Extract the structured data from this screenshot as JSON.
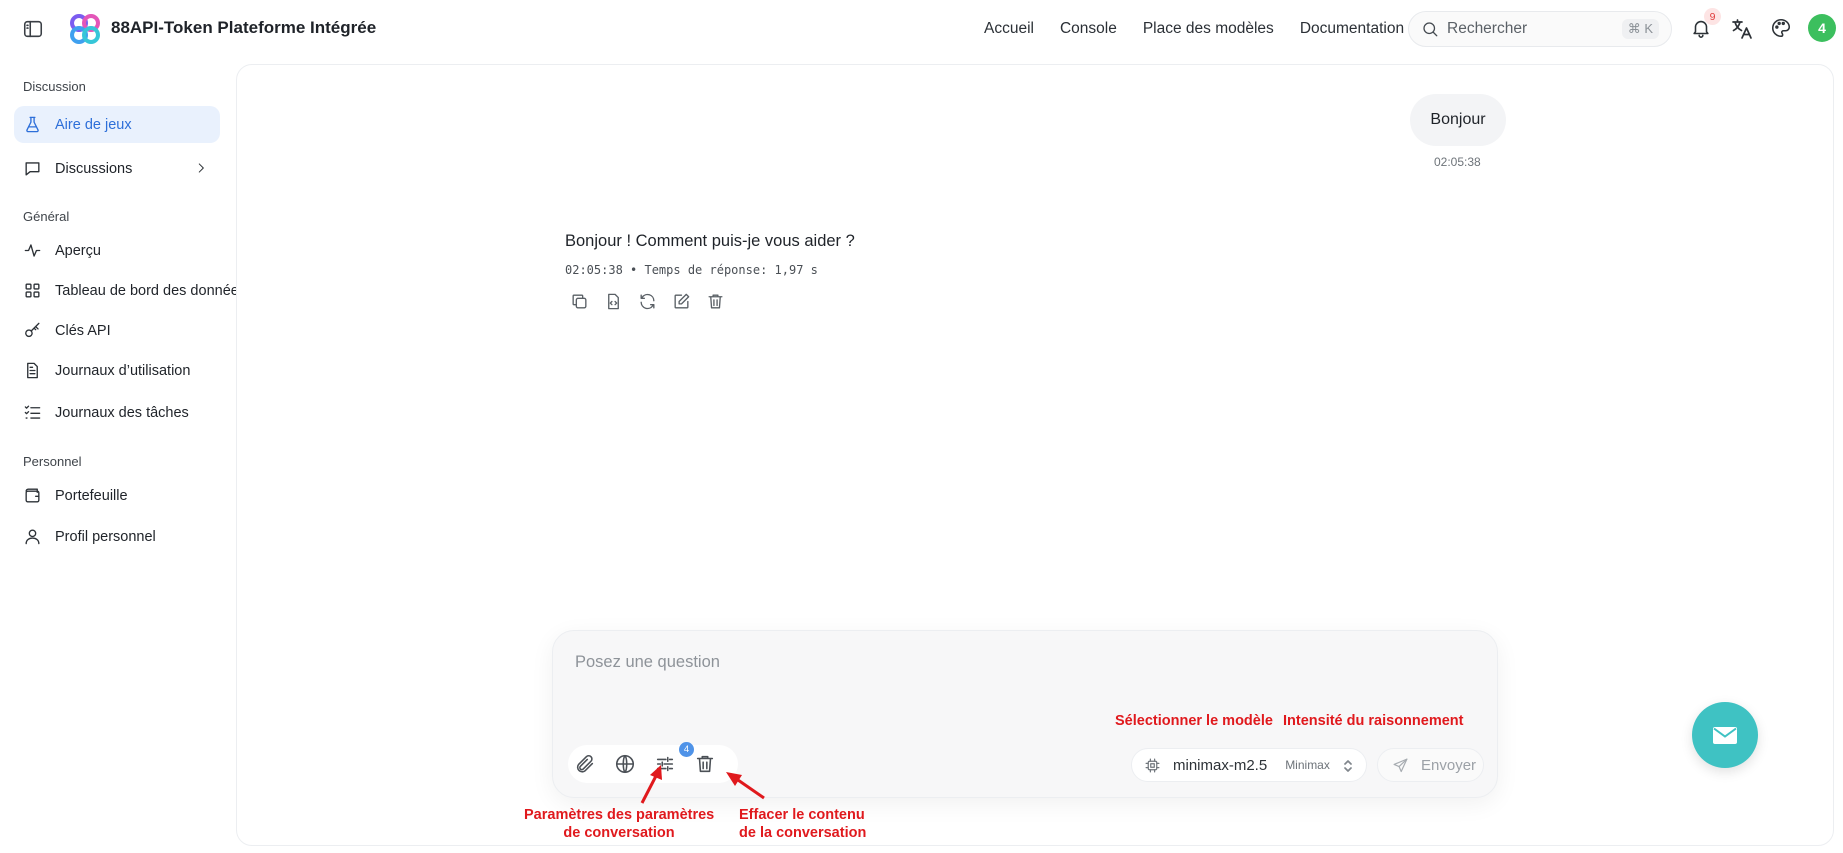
{
  "header": {
    "app_title": "88API-Token Plateforme Intégrée",
    "nav": [
      "Accueil",
      "Console",
      "Place des modèles",
      "Documentation"
    ],
    "search_placeholder": "Rechercher",
    "search_shortcut": "⌘ K",
    "notifications_count": "9",
    "avatar_initial": "4"
  },
  "sidebar": {
    "sections": [
      {
        "title": "Discussion",
        "items": [
          {
            "label": "Aire de jeux",
            "icon": "flask-icon",
            "active": true
          },
          {
            "label": "Discussions",
            "icon": "chat-icon",
            "active": false
          }
        ]
      },
      {
        "title": "Général",
        "items": [
          {
            "label": "Aperçu",
            "icon": "activity-icon"
          },
          {
            "label": "Tableau de bord des données",
            "icon": "dashboard-icon"
          },
          {
            "label": "Clés API",
            "icon": "key-icon"
          },
          {
            "label": "Journaux d’utilisation",
            "icon": "log-icon"
          },
          {
            "label": "Journaux des tâches",
            "icon": "task-list-icon"
          }
        ]
      },
      {
        "title": "Personnel",
        "items": [
          {
            "label": "Portefeuille",
            "icon": "wallet-icon"
          },
          {
            "label": "Profil personnel",
            "icon": "user-icon"
          }
        ]
      }
    ]
  },
  "chat": {
    "user_message": "Bonjour",
    "user_time": "02:05:38",
    "assistant_message": "Bonjour ! Comment puis-je vous aider ?",
    "assistant_meta": "02:05:38  •  Temps de réponse: 1,97 s"
  },
  "composer": {
    "placeholder": "Posez une question",
    "params_badge": "4",
    "model": "minimax-m2.5",
    "provider": "Minimax",
    "send_label": "Envoyer"
  },
  "annotations": {
    "select_model": "Sélectionner le modèle",
    "reasoning": "Intensité du raisonnement",
    "params_line1": "Paramètres des paramètres",
    "params_line2": "de conversation",
    "clear_line1": "Effacer le contenu",
    "clear_line2": "de la conversation"
  },
  "colors": {
    "accent": "#2d6fd9",
    "annotation": "#e0191d",
    "fab": "#3fc2c3",
    "avatar": "#3cbf5e"
  }
}
